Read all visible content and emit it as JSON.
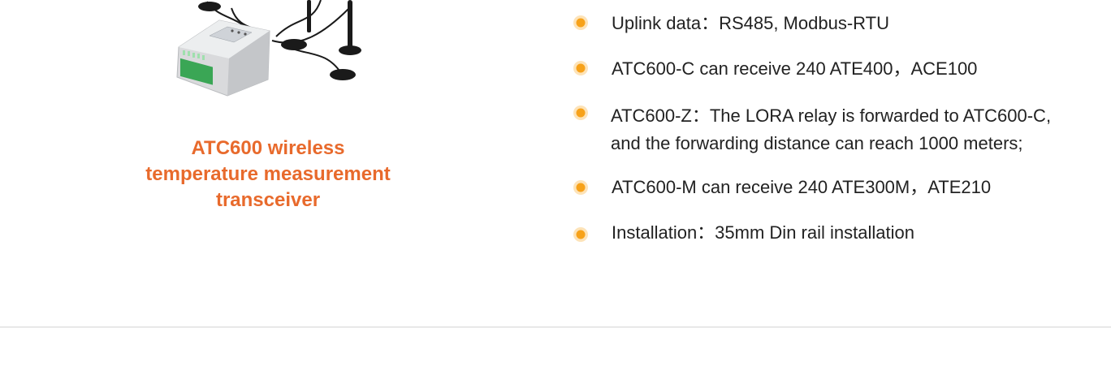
{
  "product": {
    "caption_lines": [
      "ATC600 wireless",
      "temperature measurement",
      "transceiver"
    ]
  },
  "specs": [
    {
      "label": "Uplink data：RS485, Modbus-RTU"
    },
    {
      "label": "ATC600-C can receive 240 ATE400，ACE100"
    },
    {
      "label": "ATC600-Z：The LORA relay is forwarded to ATC600-C, and the forwarding distance can reach 1000 meters;"
    },
    {
      "label": "ATC600-M can receive 240 ATE300M，ATE210"
    },
    {
      "label": "Installation：35mm Din rail installation"
    }
  ],
  "colors": {
    "caption": "#e86a2c",
    "bullet_outer": "#fde3b8",
    "bullet_inner": "#f7a21a",
    "text": "#222222"
  },
  "icons": {
    "bullet": "orange-dot-icon"
  }
}
